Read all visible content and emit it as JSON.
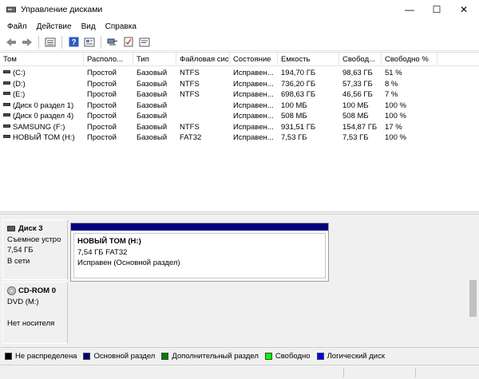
{
  "window": {
    "title": "Управление дисками",
    "minimize_glyph": "—",
    "maximize_glyph": "☐",
    "close_glyph": "✕"
  },
  "menu": [
    "Файл",
    "Действие",
    "Вид",
    "Справка"
  ],
  "toolbar_icons": [
    "back-icon",
    "forward-icon",
    "volume-list-icon",
    "help-icon",
    "properties-icon",
    "connect-icon",
    "checklist-icon",
    "settings-icon"
  ],
  "columns": [
    "Том",
    "Располо...",
    "Тип",
    "Файловая сист...",
    "Состояние",
    "Емкость",
    "Свобод...",
    "Свободно %",
    ""
  ],
  "volumes": [
    [
      "(C:)",
      "Простой",
      "Базовый",
      "NTFS",
      "Исправен...",
      "194,70 ГБ",
      "98,63 ГБ",
      "51 %"
    ],
    [
      "(D:)",
      "Простой",
      "Базовый",
      "NTFS",
      "Исправен...",
      "736,20 ГБ",
      "57,33 ГБ",
      "8 %"
    ],
    [
      "(E:)",
      "Простой",
      "Базовый",
      "NTFS",
      "Исправен...",
      "698,63 ГБ",
      "46,56 ГБ",
      "7 %"
    ],
    [
      "(Диск 0 раздел 1)",
      "Простой",
      "Базовый",
      "",
      "Исправен...",
      "100 МБ",
      "100 МБ",
      "100 %"
    ],
    [
      "(Диск 0 раздел 4)",
      "Простой",
      "Базовый",
      "",
      "Исправен...",
      "508 МБ",
      "508 МБ",
      "100 %"
    ],
    [
      "SAMSUNG (F:)",
      "Простой",
      "Базовый",
      "NTFS",
      "Исправен...",
      "931,51 ГБ",
      "154,87 ГБ",
      "17 %"
    ],
    [
      "НОВЫЙ ТОМ (H:)",
      "Простой",
      "Базовый",
      "FAT32",
      "Исправен...",
      "7,53 ГБ",
      "7,53 ГБ",
      "100 %"
    ]
  ],
  "disks": {
    "disk3": {
      "name": "Диск 3",
      "type": "Съемное устро",
      "size": "7,54 ГБ",
      "status": "В сети",
      "partition": {
        "name": "НОВЫЙ ТОМ  (H:)",
        "size_fs": "7,54 ГБ FAT32",
        "status": "Исправен (Основной раздел)"
      }
    },
    "cdrom0": {
      "name": "CD-ROM 0",
      "type": "DVD (M:)",
      "status": "Нет носителя"
    }
  },
  "legend": [
    {
      "label": "Не распределена",
      "color": "#000000"
    },
    {
      "label": "Основной раздел",
      "color": "#000080"
    },
    {
      "label": "Дополнительный раздел",
      "color": "#008000"
    },
    {
      "label": "Свободно",
      "color": "#00ff00"
    },
    {
      "label": "Логический диск",
      "color": "#0000ff"
    }
  ]
}
